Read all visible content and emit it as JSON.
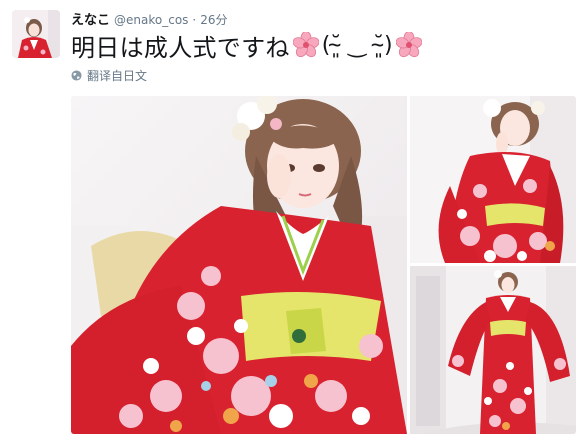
{
  "tweet": {
    "display_name": "えなこ",
    "handle": "@enako_cos",
    "separator": "·",
    "time": "26分",
    "text": "明日は成人式ですね",
    "kaomoji": "(˘̴͈ ‿ ˘̴͈)",
    "translate_label": "翻译自日文"
  },
  "icons": {
    "emoji_1": "cherry-blossom",
    "emoji_2": "cherry-blossom",
    "translate": "globe"
  },
  "colors": {
    "text": "#14171a",
    "secondary": "#657786",
    "kimono_red": "#d8222f",
    "obi_yellow": "#e4e56a"
  }
}
